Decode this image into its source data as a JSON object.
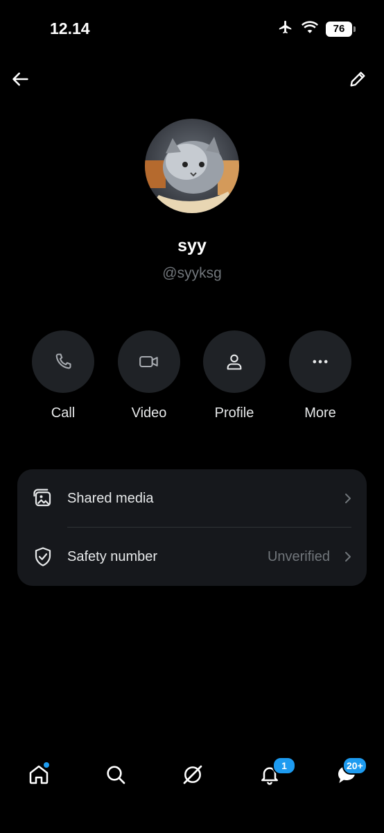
{
  "status": {
    "time": "12.14",
    "battery": "76"
  },
  "profile": {
    "name": "syy",
    "handle": "@syyksg"
  },
  "actions": [
    {
      "label": "Call",
      "icon": "phone-icon"
    },
    {
      "label": "Video",
      "icon": "video-icon"
    },
    {
      "label": "Profile",
      "icon": "person-icon"
    },
    {
      "label": "More",
      "icon": "more-icon"
    }
  ],
  "settings": {
    "shared_media": "Shared media",
    "safety_number": "Safety number",
    "safety_status": "Unverified"
  },
  "nav": {
    "notifications_badge": "1",
    "messages_badge": "20+",
    "accent": "#1d9bf0"
  }
}
